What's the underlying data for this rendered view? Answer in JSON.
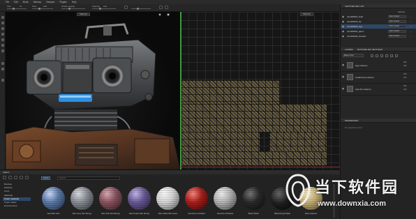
{
  "menubar": {
    "items": [
      "File",
      "Edit",
      "Mode",
      "Window",
      "Viewport",
      "Plugins",
      "Help"
    ]
  },
  "toolbar": {
    "size_label": "Size",
    "flow_label": "Flow",
    "stroke_opacity_label": "Stroke opacity",
    "spacing_label": "Spacing",
    "size_value": "12",
    "flow_value": "100",
    "spacing_value": "100"
  },
  "viewport3d": {
    "material_mode": "Material"
  },
  "viewport2d": {
    "material_mode": "Material"
  },
  "texture_set_list": {
    "header": "TEXTURE SET LIST",
    "settings_label": "Settings",
    "items": [
      {
        "name": "retroRAW26_head",
        "shader": "Main shader",
        "selected": false
      },
      {
        "name": "retroRAW26_hip",
        "shader": "Main shader",
        "selected": false
      },
      {
        "name": "retroRAW26_legs",
        "shader": "Main shader",
        "selected": true
      },
      {
        "name": "retroRAW26_piston",
        "shader": "Main shader",
        "selected": false
      },
      {
        "name": "retroRAW26_shoulder",
        "shader": "Main shader",
        "selected": false
      }
    ]
  },
  "layers": {
    "tab_layers": "LAYERS",
    "tab_settings": "TEXTURE SET SETTINGS",
    "blend_mode": "Base Color",
    "items": [
      {
        "name": "legs instance",
        "blend": "Pthr",
        "opacity": "100"
      },
      {
        "name": "weathering instance",
        "blend": "Pthr",
        "opacity": "100"
      },
      {
        "name": "leak dirt instance",
        "blend": "Pthr",
        "opacity": "100"
      }
    ]
  },
  "properties": {
    "header": "PROPERTIES",
    "hint": "No properties found"
  },
  "shelf": {
    "header": "SHELF",
    "filter_chip": "Smart",
    "search_placeholder": "Search...",
    "categories": [
      {
        "label": "Brushes",
        "active": false
      },
      {
        "label": "Particles",
        "active": false
      },
      {
        "label": "Tools",
        "active": false
      },
      {
        "label": "Materials",
        "active": false
      },
      {
        "label": "Smart materials",
        "active": true
      },
      {
        "label": "Smart masks",
        "active": false
      },
      {
        "label": "Environments",
        "active": false
      }
    ],
    "materials": [
      {
        "label": "Alien Blue Skin",
        "color": "#5c7aa8"
      },
      {
        "label": "Alien Grey Skin Bumpy",
        "color": "#8a8f96"
      },
      {
        "label": "Alien Pink Skin Bumpy",
        "color": "#8a5560"
      },
      {
        "label": "Alien Purple Skin Bumpy",
        "color": "#6a5a96"
      },
      {
        "label": "Alien White Skin Insect",
        "color": "#d6d6d6"
      },
      {
        "label": "Aluminium Anodized",
        "color": "#a8201c"
      },
      {
        "label": "Aluminium Brushed",
        "color": "#b5b5b5"
      },
      {
        "label": "Black Plastic",
        "color": "#2a2a2a"
      },
      {
        "label": "Black Rough Metal",
        "color": "#1e1e1e"
      },
      {
        "label": "Bone Stylized",
        "color": "#c7b27a"
      }
    ]
  },
  "watermark": {
    "title": "当下软件园",
    "url": "www.downxia.com"
  },
  "colors": {
    "accent": "#2f4766",
    "uv_line": "#3f9a3f"
  }
}
